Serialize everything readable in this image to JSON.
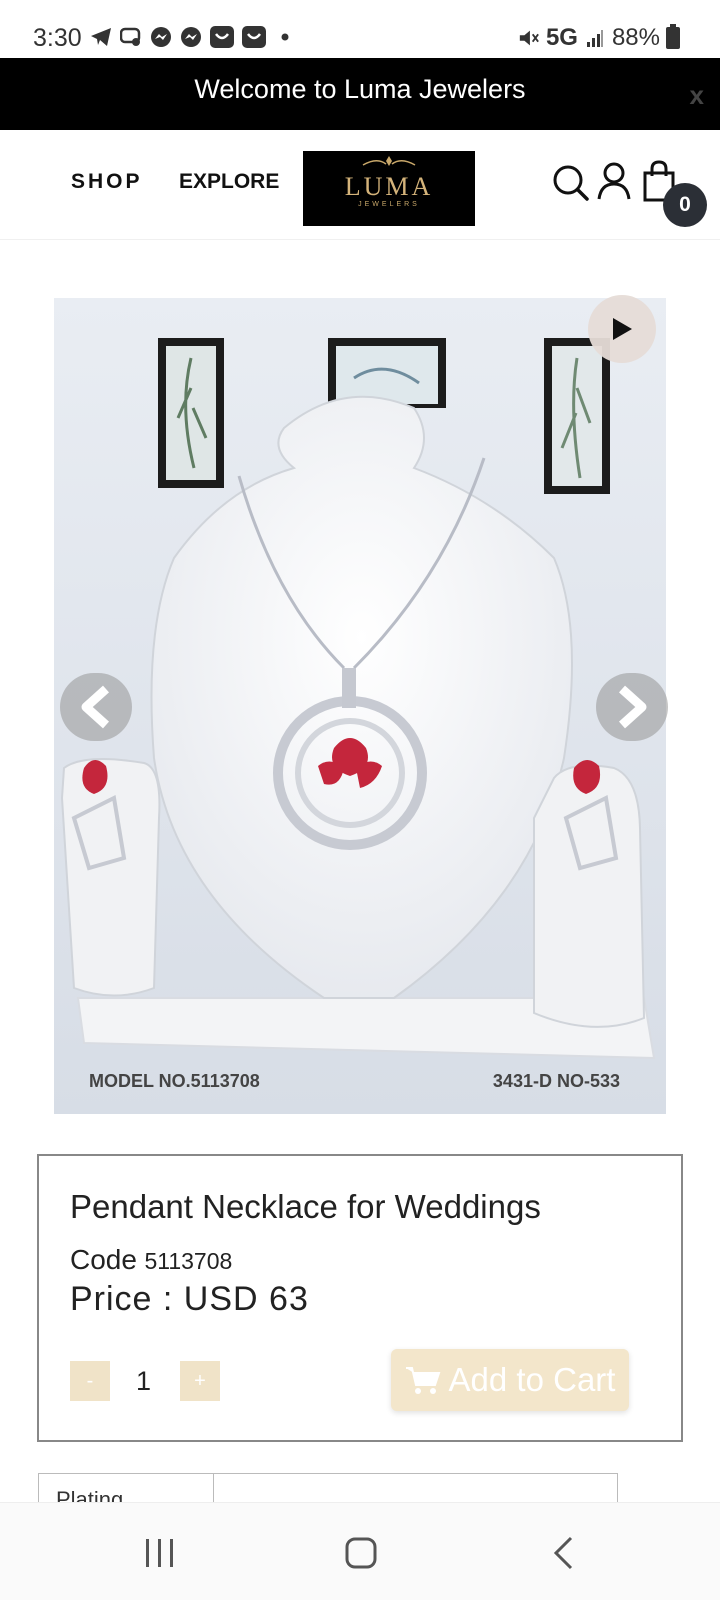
{
  "status_bar": {
    "time": "3:30",
    "network": "5G",
    "battery": "88%"
  },
  "banner": {
    "text": "Welcome to Luma Jewelers",
    "close_label": "x"
  },
  "header": {
    "nav_shop": "SHOP",
    "nav_explore": "EXPLORE",
    "logo_name": "LUMA",
    "logo_sub": "JEWELERS",
    "cart_count": "0"
  },
  "product_image": {
    "caption_left": "MODEL NO.5113708",
    "caption_right": "3431-D NO-533"
  },
  "product": {
    "title": "Pendant Necklace for Weddings",
    "code_label": "Code",
    "code_value": "5113708",
    "price": "Price : USD 63",
    "qty_minus": "-",
    "qty_value": "1",
    "qty_plus": "+",
    "add_to_cart": "Add to Cart"
  },
  "specs": {
    "first_label": "Plating"
  },
  "colors": {
    "banner_bg": "#000000",
    "accent_gold": "#f0e3c8",
    "badge_bg": "#2b2f36"
  }
}
